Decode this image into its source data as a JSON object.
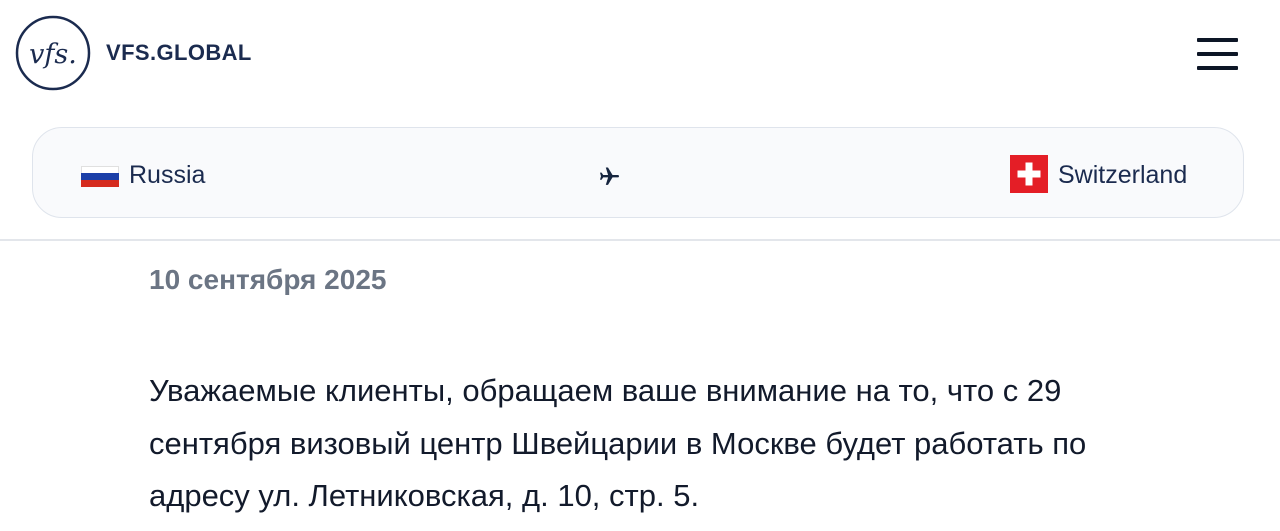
{
  "header": {
    "logo_mark": "vfs.",
    "logo_text": "VFS.GLOBAL",
    "menu_icon": "hamburger-menu-icon"
  },
  "route": {
    "from": {
      "country": "Russia",
      "flag": "russia-flag-icon",
      "flag_colors": [
        "#ffffff",
        "#1c3fa8",
        "#d52b1e"
      ]
    },
    "arrow_icon": "airplane-icon",
    "to": {
      "country": "Switzerland",
      "flag": "switzerland-flag-icon",
      "flag_colors": [
        "#e41e26",
        "#ffffff"
      ]
    }
  },
  "article": {
    "date": "10 сентября 2025",
    "body": "Уважаемые клиенты, обращаем ваше внимание на то, что с 29 сентября визовый центр Швейцарии в Москве будет работать по адресу ул. Летниковская, д. 10, стр. 5."
  },
  "colors": {
    "brand": "#1b2b4f",
    "date_text": "#6b7584",
    "card_background": "#f9fafc",
    "card_border": "#dfe4ec"
  }
}
